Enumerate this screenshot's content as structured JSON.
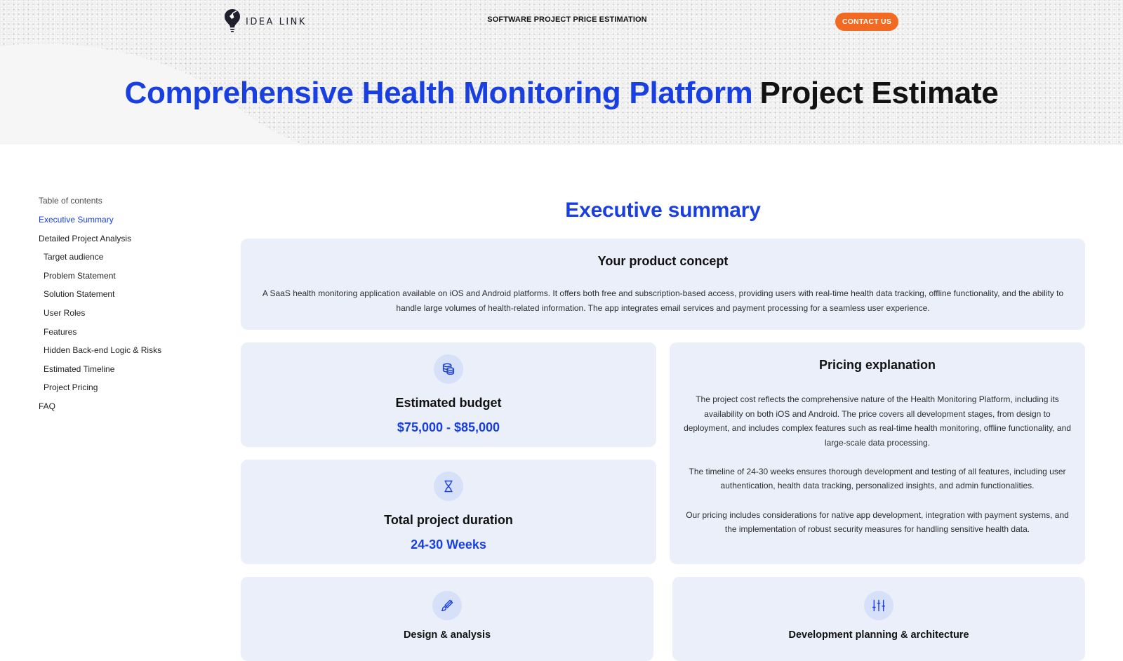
{
  "header": {
    "logo_text": "IDEA LINK",
    "title": "SOFTWARE PROJECT PRICE ESTIMATION",
    "contact_label": "CONTACT US"
  },
  "hero": {
    "title_accent": "Comprehensive Health Monitoring Platform",
    "title_rest": "Project Estimate"
  },
  "toc": {
    "heading": "Table of contents",
    "items": [
      {
        "label": "Executive Summary"
      },
      {
        "label": "Detailed Project Analysis"
      },
      {
        "label": "Target audience"
      },
      {
        "label": "Problem Statement"
      },
      {
        "label": "Solution Statement"
      },
      {
        "label": "User Roles"
      },
      {
        "label": "Features"
      },
      {
        "label": "Hidden Back-end Logic & Risks"
      },
      {
        "label": "Estimated Timeline"
      },
      {
        "label": "Project Pricing"
      },
      {
        "label": "FAQ"
      }
    ]
  },
  "main": {
    "section_title": "Executive summary",
    "concept": {
      "title": "Your product concept",
      "text": "A SaaS health monitoring application available on iOS and Android platforms. It offers both free and subscription-based access, providing users with real-time health data tracking, offline functionality, and the ability to handle large volumes of health-related information. The app integrates email services and payment processing for a seamless user experience."
    },
    "budget": {
      "title": "Estimated budget",
      "value": "$75,000 - $85,000",
      "icon": "coins-icon"
    },
    "duration": {
      "title": "Total project duration",
      "value": "24-30 Weeks",
      "icon": "hourglass-icon"
    },
    "pricing": {
      "title": "Pricing explanation",
      "paragraphs": [
        "The project cost reflects the comprehensive nature of the Health Monitoring Platform, including its availability on both iOS and Android. The price covers all development stages, from design to deployment, and includes complex features such as real-time health monitoring, offline functionality, and large-scale data processing.",
        "The timeline of 24-30 weeks ensures thorough development and testing of all features, including user authentication, health data tracking, personalized insights, and admin functionalities.",
        "Our pricing includes considerations for native app development, integration with payment systems, and the implementation of robust security measures for handling sensitive health data."
      ]
    },
    "phases": [
      {
        "title": "Design & analysis",
        "icon": "brush-icon"
      },
      {
        "title": "Development planning & architecture",
        "icon": "sliders-icon"
      }
    ]
  },
  "colors": {
    "accent": "#1a3fe0",
    "cta": "#f26a21",
    "card_bg": "#eaeffa",
    "icon_circle": "#d6e0f8"
  }
}
